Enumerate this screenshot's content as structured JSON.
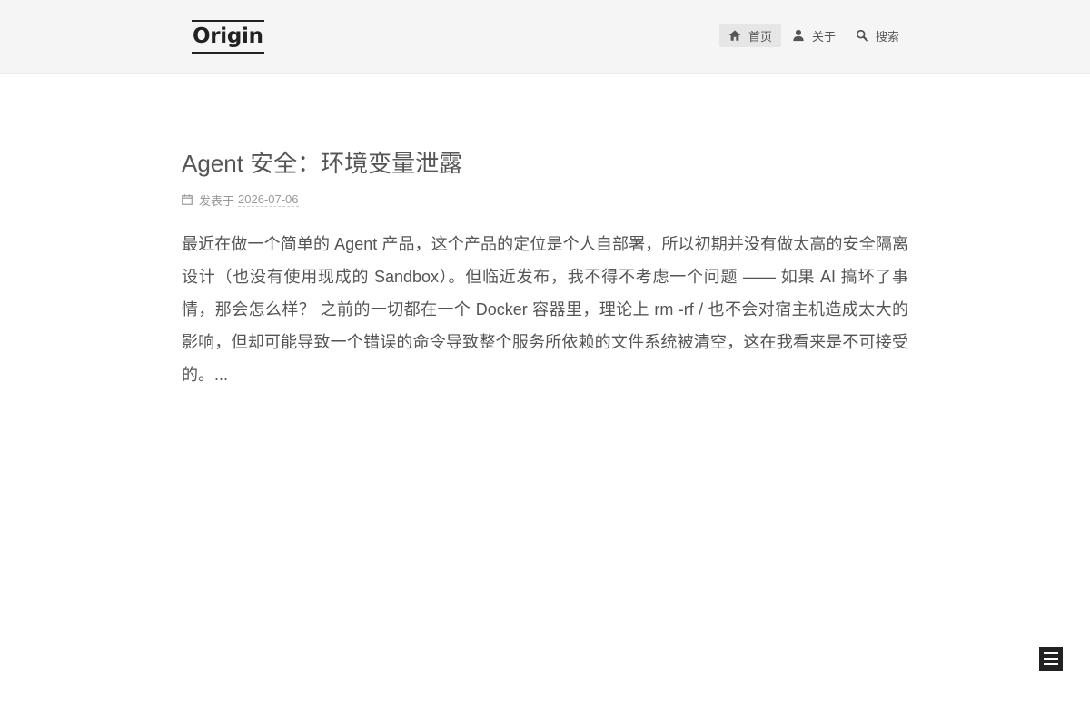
{
  "site": {
    "logo_text": "Origin"
  },
  "nav": {
    "items": [
      {
        "label": "首页",
        "icon": "home-icon",
        "active": true
      },
      {
        "label": "关于",
        "icon": "user-icon",
        "active": false
      },
      {
        "label": "搜索",
        "icon": "search-icon",
        "active": false
      }
    ]
  },
  "post": {
    "title": "Agent 安全：环境变量泄露",
    "meta_prefix": "发表于",
    "date": "2026-07-06",
    "excerpt": "最近在做一个简单的 Agent 产品，这个产品的定位是个人自部署，所以初期并没有做太高的安全隔离设计（也没有使用现成的 Sandbox）。但临近发布，我不得不考虑一个问题 —— 如果 AI 搞坏了事情，那会怎么样？ 之前的一切都在一个 Docker 容器里，理论上 rm -rf / 也不会对宿主机造成太大的影响，但却可能导致一个错误的命令导致整个服务所依赖的文件系统被清空，这在我看来是不可接受的。..."
  },
  "sidebar_toggle": {
    "icon": "menu-icon"
  },
  "colors": {
    "header_bg": "#f5f5f5",
    "active_nav_bg": "#e6e6e6",
    "text": "#555555",
    "meta": "#999999",
    "toggle_bg": "#222222"
  }
}
